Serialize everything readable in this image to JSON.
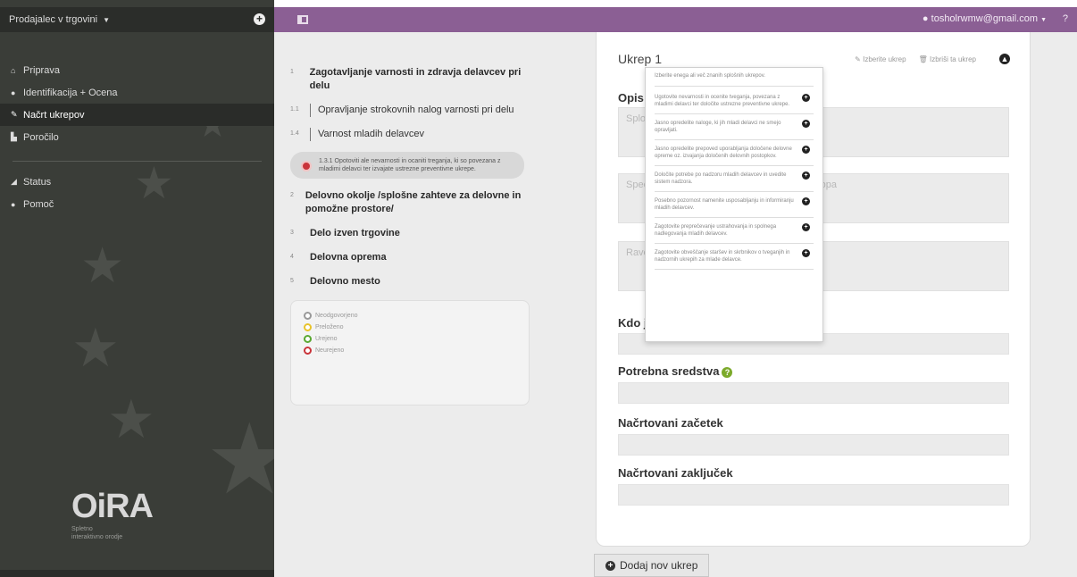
{
  "sidebar": {
    "dropdown_label": "Prodajalec v trgovini",
    "items": [
      {
        "label": "Priprava",
        "icon": "home-icon"
      },
      {
        "label": "Identifikacija + Ocena",
        "icon": "eye-icon"
      },
      {
        "label": "Načrt ukrepov",
        "icon": "pencil-icon"
      },
      {
        "label": "Poročilo",
        "icon": "report-icon"
      },
      {
        "label": "Status",
        "icon": "chart-icon"
      },
      {
        "label": "Pomoč",
        "icon": "help-icon"
      }
    ],
    "active_index": 2,
    "logo_text": "OiRA",
    "logo_subtext": "Spletno interaktivno orodje"
  },
  "topbar": {
    "user_email": "tosholrwmw@gmail.com",
    "help": "?"
  },
  "tree": {
    "items": [
      {
        "num": "1",
        "label": "Zagotavljanje varnosti in zdravja delavcev pri delu",
        "level": 1
      },
      {
        "num": "1.1",
        "label": "Opravljanje strokovnih nalog varnosti pri delu",
        "level": 2
      },
      {
        "num": "1.4",
        "label": "Varnost mladih delavcev",
        "level": 2
      }
    ],
    "current_text": "1.3.1 Opotoviti ale nevarnosti in ocaniti treganja, ki so povezana z mladimi delavci ter izvajate ustrezne preventivne ukrepe.",
    "items_after": [
      {
        "num": "2",
        "label": "Delovno okolje /splošne zahteve za delovne in pomožne prostore/",
        "level": 1
      },
      {
        "num": "3",
        "label": "Delo izven trgovine",
        "level": 1
      },
      {
        "num": "4",
        "label": "Delovna oprema",
        "level": 1
      },
      {
        "num": "5",
        "label": "Delovno mesto",
        "level": 1
      }
    ]
  },
  "legend": {
    "items": [
      {
        "label": "Neodgovorjeno",
        "color": "#999999"
      },
      {
        "label": "Preloženo",
        "color": "#e8c32a"
      },
      {
        "label": "Urejeno",
        "color": "#5aa832"
      },
      {
        "label": "Neurejeno",
        "color": "#c9343a"
      }
    ]
  },
  "form": {
    "title": "Ukrep 1",
    "action_select": "Izberite ukrep",
    "action_delete": "Izbriši ta ukrep",
    "opis_label": "Opis",
    "opis_placeholder": "Splošni opis ukrepa (za zmanjšanje tveganja)",
    "specific_placeholder": "Specifični ukrepi za izvajanje splošnega pristopa",
    "level_placeholder": "Raven strokovnega znanja, ki je potrebna",
    "kdo_label": "Kdo je odgovoren?",
    "sredstva_label": "Potrebna sredstva",
    "zacetek_label": "Načrtovani začetek",
    "zakljucek_label": "Načrtovani zaključek",
    "add_button": "Dodaj nov ukrep"
  },
  "dropdown": {
    "header": "Izberite enega ali več znanih splošnih ukrepov.",
    "items": [
      "Ugotovite nevarnosti in ocenite tveganja, povezana z mladimi delavci ter določite ustrezne preventivne ukrepe.",
      "Jasno opredelite naloge, ki jih mladi delavci ne smejo opravljati.",
      "Jasno opredelite prepoved uporabljanja določene delovne opreme oz. izvajanja določenih delovnih postopkov.",
      "Določite potrebe po nadzoru mladih delavcev in uvedite sistem nadzora.",
      "Posebno pozornost namenite usposabljanju in informiranju mladih delavcev.",
      "Zagotovite preprečevanje ustrahovanja in spolnega nadlegovanja mladih delavcev.",
      "Zagotovite obveščanje staršev in skrbnikov o tveganjih in nadzornih ukrepih za mlade delavce."
    ]
  }
}
